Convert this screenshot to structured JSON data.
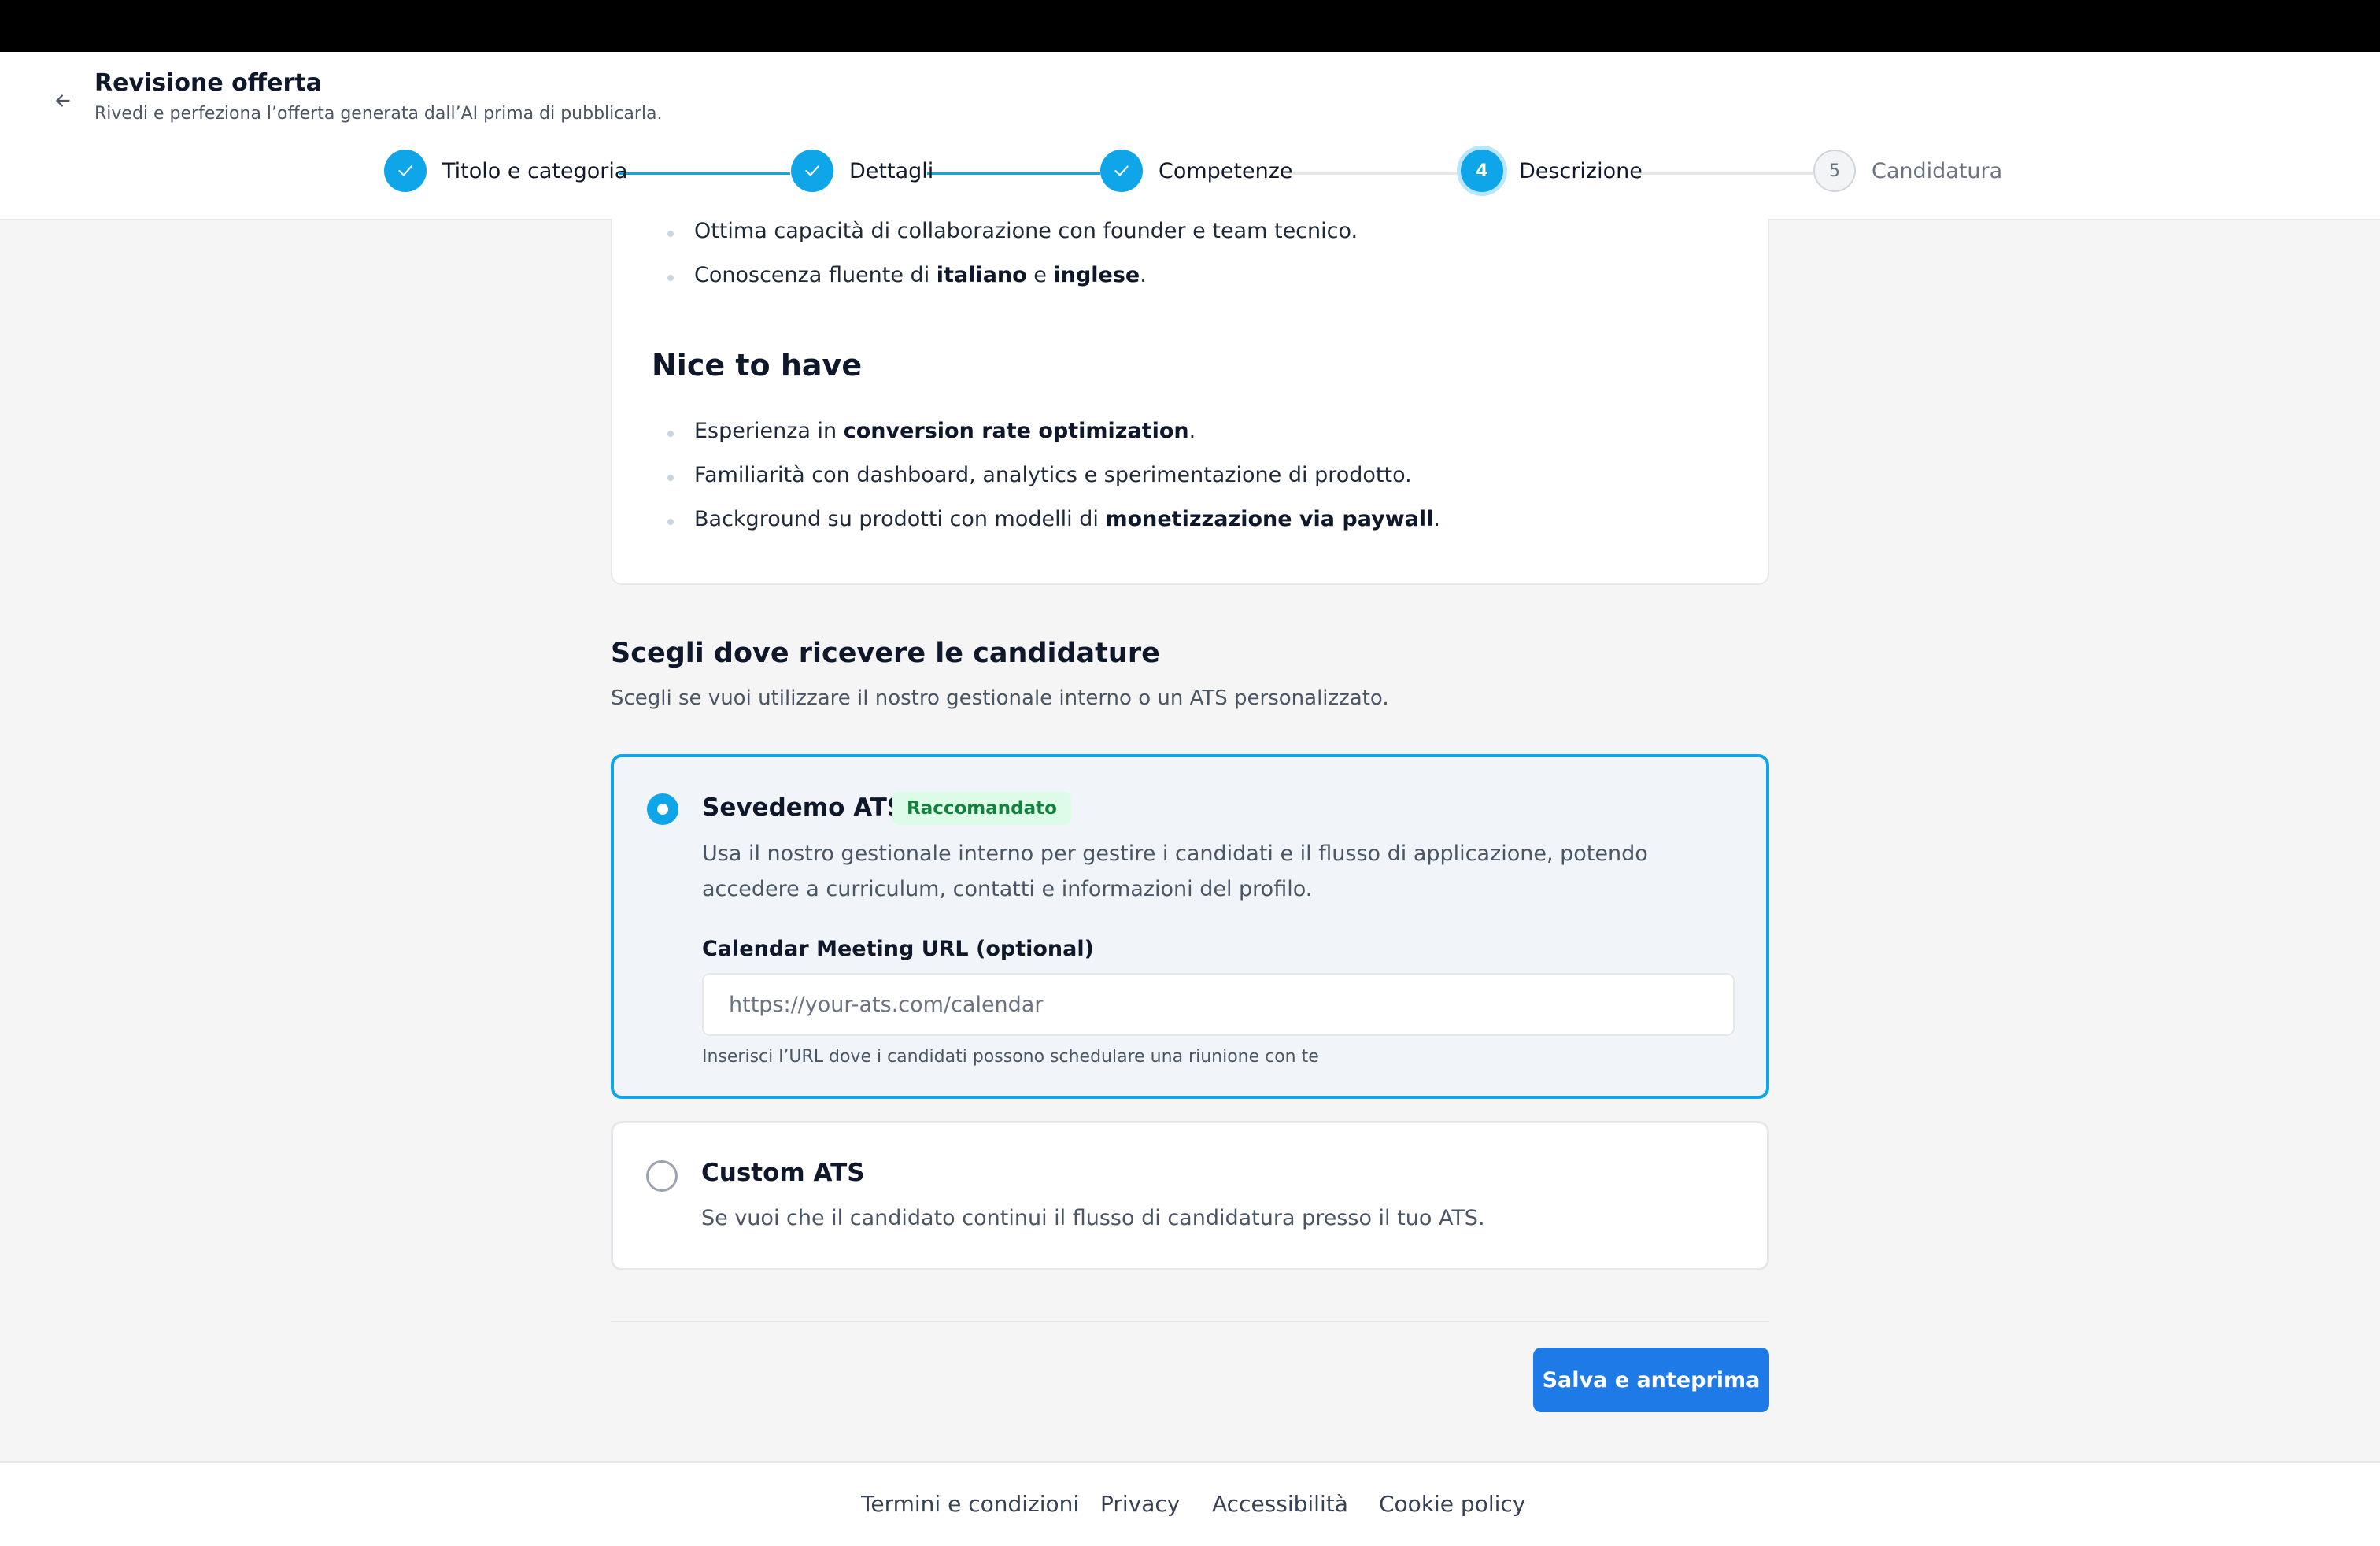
{
  "header": {
    "title": "Revisione offerta",
    "subtitle": "Rivedi e perfeziona l’offerta generata dall’AI prima di pubblicarla.",
    "back_icon": "arrow-left-icon"
  },
  "stepper": {
    "steps": [
      {
        "label": "Titolo e categoria",
        "state": "done",
        "icon": "check-icon"
      },
      {
        "label": "Dettagli",
        "state": "done",
        "icon": "check-icon"
      },
      {
        "label": "Competenze",
        "state": "done",
        "icon": "check-icon"
      },
      {
        "label": "Descrizione",
        "state": "active",
        "number": "4"
      },
      {
        "label": "Candidatura",
        "state": "pending",
        "number": "5"
      }
    ]
  },
  "requirements": {
    "items": [
      {
        "text": "Ottima capacità di collaborazione con founder e team tecnico."
      },
      {
        "pre": "Conoscenza fluente di ",
        "b1": "italiano",
        "mid": " e ",
        "b2": "inglese",
        "post": "."
      }
    ]
  },
  "nice_to_have": {
    "title": "Nice to have",
    "items": [
      {
        "pre": "Esperienza in ",
        "bold": "conversion rate optimization",
        "post": "."
      },
      {
        "text": "Familiarità con dashboard, analytics e sperimentazione di prodotto."
      },
      {
        "pre": "Background su prodotti con modelli di ",
        "bold": "monetizzazione via paywall",
        "post": "."
      }
    ]
  },
  "applications": {
    "title": "Scegli dove ricevere le candidature",
    "subtitle": "Scegli se vuoi utilizzare il nostro gestionale interno o un ATS personalizzato.",
    "options": [
      {
        "title": "Sevedemo ATS",
        "badge": "Raccomandato",
        "selected": true,
        "description": "Usa il nostro gestionale interno per gestire i candidati e il flusso di applicazione, potendo accedere a curriculum, contatti e informazioni del profilo.",
        "field_label": "Calendar Meeting URL (optional)",
        "field_placeholder": "https://your-ats.com/calendar",
        "field_value": "",
        "field_hint": "Inserisci l’URL dove i candidati possono schedulare una riunione con te"
      },
      {
        "title": "Custom ATS",
        "selected": false,
        "description": "Se vuoi che il candidato continui il flusso di candidatura presso il tuo ATS."
      }
    ]
  },
  "actions": {
    "save_label": "Salva e anteprima"
  },
  "footer": {
    "links": [
      "Termini e condizioni",
      "Privacy",
      "Accessibilità",
      "Cookie policy"
    ]
  },
  "colors": {
    "accent": "#0ea5e9",
    "primary_button": "#1d7ae6",
    "badge_bg": "#dcfce7",
    "badge_text": "#15803d"
  }
}
